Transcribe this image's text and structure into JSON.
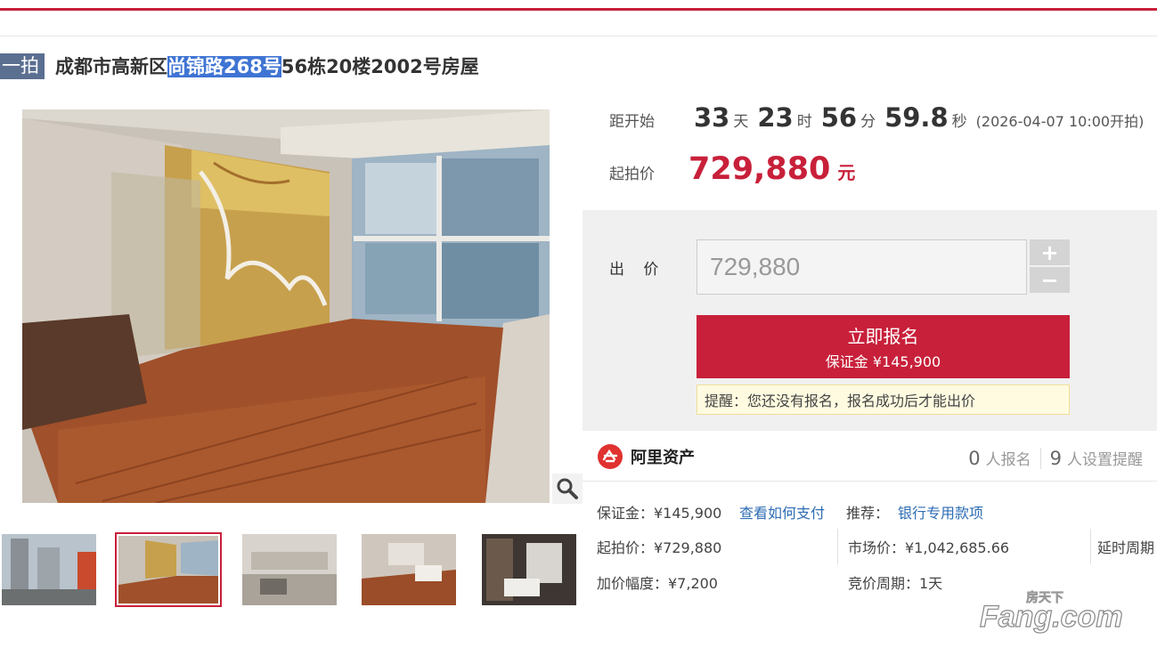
{
  "header": {
    "tag": "一拍",
    "title_prefix": "成都市高新区",
    "title_highlight": "尚锦路268号",
    "title_suffix": "56栋20楼2002号房屋"
  },
  "countdown": {
    "label": "距开始",
    "days": "33",
    "days_unit": "天",
    "hours": "23",
    "hours_unit": "时",
    "minutes": "56",
    "minutes_unit": "分",
    "seconds": "59.8",
    "seconds_unit": "秒",
    "start_note": "(2026-04-07 10:00开拍)"
  },
  "start_price": {
    "label": "起拍价",
    "value": "729,880",
    "unit": "元"
  },
  "bid": {
    "label": "出 价",
    "input_value": "729,880",
    "plus": "+",
    "minus": "−",
    "signup_label": "立即报名",
    "deposit_label": "保证金 ¥145,900",
    "notice": "提醒：您还没有报名，报名成功后才能出价"
  },
  "platform": {
    "name": "阿里资产",
    "signup_count": "0",
    "signup_text": "人报名",
    "remind_count": "9",
    "remind_text": "人设置提醒"
  },
  "details": {
    "deposit": "保证金：¥145,900",
    "pay_link": "查看如何支付",
    "recommend_label": "推荐：",
    "recommend_link": "银行专用款项",
    "start_price": "起拍价：¥729,880",
    "market_price": "市场价：¥1,042,685.66",
    "delay": "延时周期",
    "increment": "加价幅度：¥7,200",
    "bid_cycle": "竞价周期：1天"
  },
  "watermark": {
    "top": "房天下",
    "brand": "Fang.com"
  },
  "colors": {
    "accent_red": "#c8203a",
    "tag_blue": "#5b6f90",
    "link_blue": "#2e6db5",
    "highlight_blue": "#3f74d4"
  },
  "icons": [
    "magnifier-icon",
    "ali-assets-logo-icon"
  ]
}
